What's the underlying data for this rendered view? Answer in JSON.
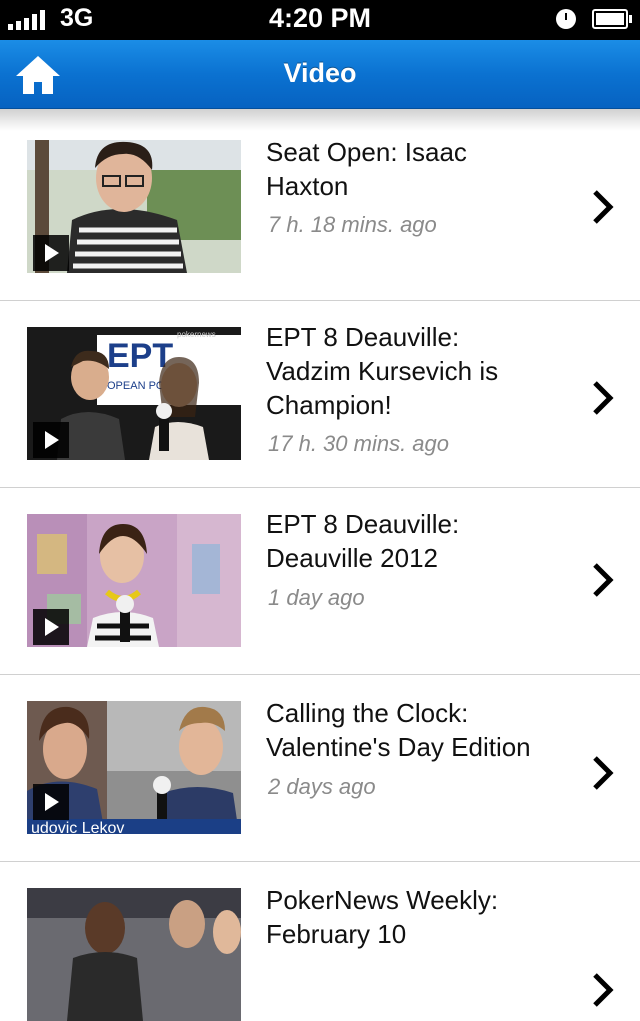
{
  "status_bar": {
    "carrier": "3G",
    "time": "4:20 PM"
  },
  "nav": {
    "title": "Video"
  },
  "videos": [
    {
      "title_line1": "Seat Open: Isaac",
      "title_line2": "Haxton",
      "title_line3": "",
      "ago": "7 h. 18 mins. ago"
    },
    {
      "title_line1": "EPT 8 Deauville:",
      "title_line2": "Vadzim Kursevich is",
      "title_line3": "Champion!",
      "ago": "17 h. 30 mins. ago"
    },
    {
      "title_line1": "EPT 8 Deauville:",
      "title_line2": "Deauville 2012",
      "title_line3": "",
      "ago": "1 day ago"
    },
    {
      "title_line1": "Calling the Clock:",
      "title_line2": "Valentine's Day Edition",
      "title_line3": "",
      "ago": "2 days ago"
    },
    {
      "title_line1": "PokerNews Weekly:",
      "title_line2": "February 10",
      "title_line3": "",
      "ago": ""
    }
  ],
  "thumb_overlays": {
    "poker_logo": "pokernews",
    "ept_logo": "EPT",
    "ept_sub": "OPEAN POK",
    "caption": "udovic Lekov"
  },
  "icons": {
    "home": "home-icon",
    "play": "play-icon",
    "chevron": "chevron-right-icon",
    "alarm": "alarm-clock-icon",
    "battery": "battery-icon",
    "signal": "signal-bars-icon"
  }
}
